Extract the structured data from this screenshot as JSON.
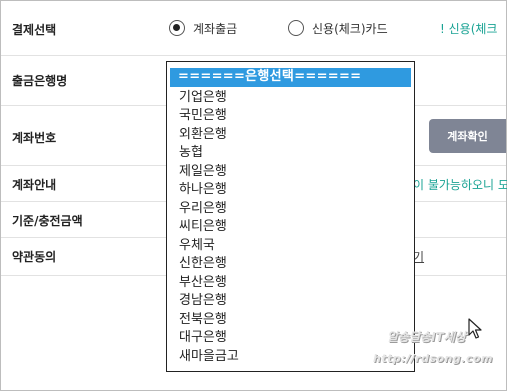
{
  "form": {
    "payment": {
      "label": "결제선택",
      "options": [
        {
          "label": "계좌출금",
          "selected": true
        },
        {
          "label": "신용(체크)카드",
          "selected": false
        }
      ],
      "notice": "! 신용(체크"
    },
    "bank": {
      "label": "출금은행명"
    },
    "account": {
      "label": "계좌번호",
      "verify_button": "계좌확인"
    },
    "account_guide": {
      "label": "계좌안내",
      "note": "이 불가능하오니 도"
    },
    "standard_amount": {
      "label": "기준/충전금액"
    },
    "terms": {
      "label": "약관동의",
      "link_fragment": "기"
    }
  },
  "bank_dropdown": {
    "selected_label": "======은행선택======",
    "options": [
      "기업은행",
      "국민은행",
      "외환은행",
      "농협",
      "제일은행",
      "하나은행",
      "우리은행",
      "씨티은행",
      "우체국",
      "신한은행",
      "부산은행",
      "경남은행",
      "전북은행",
      "대구은행",
      "새마을금고"
    ]
  },
  "watermark": {
    "line1": "알송달송IT세상",
    "line2": "http://rdsong.com"
  },
  "colors": {
    "accent_teal": "#1aa394",
    "button_gray": "#7f8595",
    "selection_blue": "#2f9ae0"
  },
  "icons": [
    "radio-selected-icon",
    "radio-unselected-icon",
    "mouse-cursor-icon"
  ]
}
